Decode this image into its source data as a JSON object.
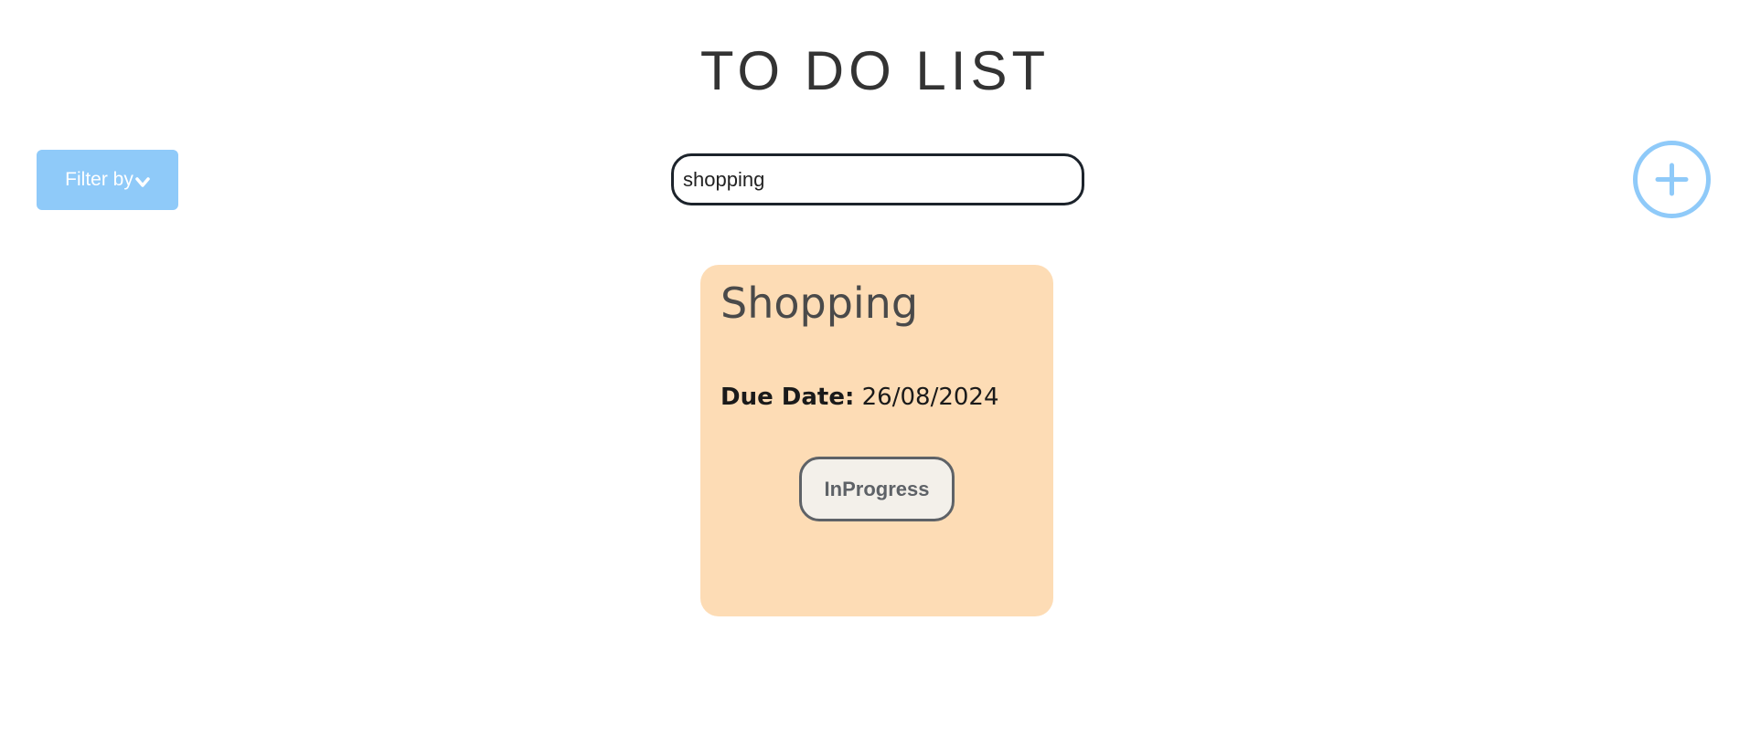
{
  "header": {
    "title": "TO DO LIST"
  },
  "toolbar": {
    "filter_label": "Filter by",
    "search": {
      "value": "shopping",
      "placeholder": ""
    },
    "add_icon": "plus-circle-icon"
  },
  "tasks": [
    {
      "title": "Shopping",
      "due_label": "Due Date:",
      "due_date": "26/08/2024",
      "status": "InProgress"
    }
  ],
  "colors": {
    "accent": "#8fcaf9",
    "card_background": "#fddcb5",
    "title_text": "#333333",
    "status_border": "#5e6267"
  }
}
